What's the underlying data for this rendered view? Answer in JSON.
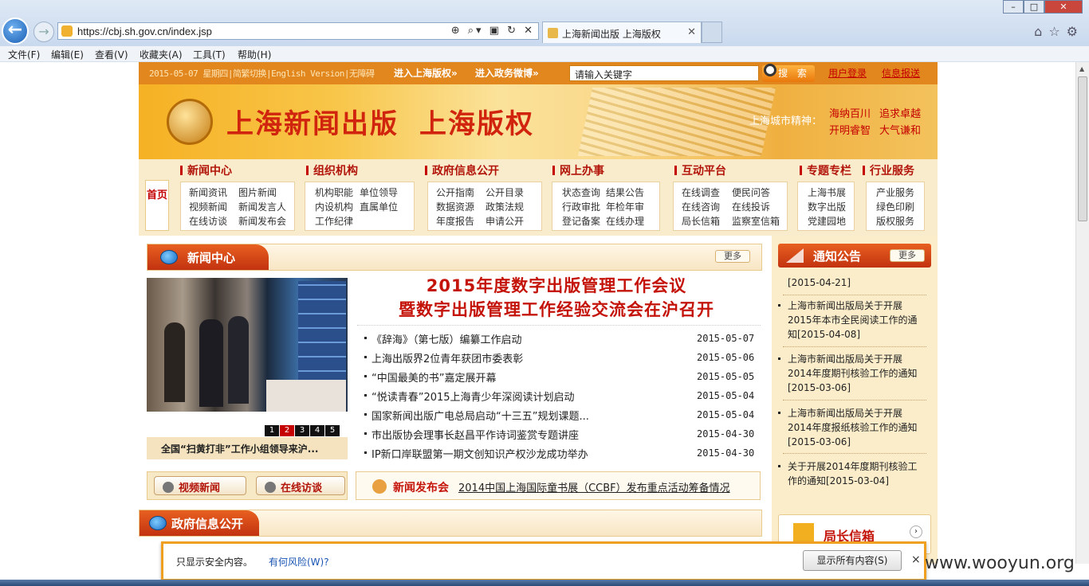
{
  "browser": {
    "url": "https://cbj.sh.gov.cn/index.jsp",
    "tab_title": "上海新闻出版 上海版权",
    "menu": [
      "文件(F)",
      "编辑(E)",
      "查看(V)",
      "收藏夹(A)",
      "工具(T)",
      "帮助(H)"
    ]
  },
  "site": {
    "topbar": {
      "date": "2015-05-07 星期四|简繁切换|English Version|无障碍",
      "link_copyright": "进入上海版权»",
      "link_weibo": "进入政务微博»",
      "search_placeholder": "请输入关键字",
      "search_button": "搜 索",
      "login": "用户登录",
      "report": "信息报送"
    },
    "banner": {
      "title1": "上海新闻出版",
      "title2": "上海版权",
      "spirit_label": "上海城市精神：",
      "spirit": [
        "海纳百川",
        "追求卓越",
        "开明睿智",
        "大气谦和"
      ]
    },
    "nav": {
      "home": "首页",
      "sections": [
        {
          "title": "新闻中心",
          "links": [
            "新闻资讯",
            "图片新闻",
            "视频新闻",
            "新闻发言人",
            "在线访谈",
            "新闻发布会"
          ]
        },
        {
          "title": "组织机构",
          "links": [
            "机构职能",
            "单位领导",
            "内设机构",
            "直属单位",
            "工作纪律"
          ]
        },
        {
          "title": "政府信息公开",
          "links": [
            "公开指南",
            "公开目录",
            "数据资源",
            "政策法规",
            "年度报告",
            "申请公开"
          ]
        },
        {
          "title": "网上办事",
          "links": [
            "状态查询",
            "结果公告",
            "行政审批",
            "年检年审",
            "登记备案",
            "在线办理"
          ]
        },
        {
          "title": "互动平台",
          "links": [
            "在线调查",
            "便民问答",
            "在线咨询",
            "在线投诉",
            "局长信箱",
            "监察室信箱"
          ]
        },
        {
          "title": "专题专栏",
          "links": [
            "上海书展",
            "数字出版",
            "党建园地"
          ]
        },
        {
          "title": "行业服务",
          "links": [
            "产业服务",
            "绿色印刷",
            "版权服务"
          ]
        }
      ]
    },
    "news_center": {
      "title": "新闻中心",
      "more": "更多",
      "headline1": "2015年度数字出版管理工作会议",
      "headline2": "暨数字出版管理工作经验交流会在沪召开",
      "pager": [
        "1",
        "2",
        "3",
        "4",
        "5"
      ],
      "photo_caption": "全国“扫黄打非”工作小组领导来沪...",
      "items": [
        {
          "title": "《辞海》（第七版）编纂工作启动",
          "date": "2015-05-07"
        },
        {
          "title": "上海出版界2位青年获团市委表彰",
          "date": "2015-05-06"
        },
        {
          "title": "“中国最美的书”嘉定展开幕",
          "date": "2015-05-05"
        },
        {
          "title": "“悦读青春”2015上海青少年深阅读计划启动",
          "date": "2015-05-04"
        },
        {
          "title": "国家新闻出版广电总局启动“十三五”规划课题...",
          "date": "2015-05-04"
        },
        {
          "title": "市出版协会理事长赵昌平作诗词鉴赏专题讲座",
          "date": "2015-04-30"
        },
        {
          "title": "IP新口岸联盟第一期文创知识产权沙龙成功举办",
          "date": "2015-04-30"
        }
      ],
      "video_news": "视频新闻",
      "online_interview": "在线访谈",
      "press_label": "新闻发布会",
      "press_text": "2014中国上海国际童书展（CCBF）发布重点活动筹备情况"
    },
    "gov_info": {
      "title": "政府信息公开"
    },
    "notice": {
      "title": "通知公告",
      "more": "更多",
      "top_date": "[2015-04-21]",
      "items": [
        "上海市新闻出版局关于开展2015年本市全民阅读工作的通知[2015-04-08]",
        "上海市新闻出版局关于开展2014年度期刊核验工作的通知[2015-03-06]",
        "上海市新闻出版局关于开展2014年度报纸核验工作的通知[2015-03-06]",
        "关于开展2014年度期刊核验工作的通知[2015-03-04]"
      ],
      "mailbox": "局长信箱"
    }
  },
  "security_bar": {
    "message": "只显示安全内容。",
    "risk_link": "有何风险(W)?",
    "show_all": "显示所有内容(S)",
    "close": "×"
  },
  "watermark": "www.wooyun.org"
}
